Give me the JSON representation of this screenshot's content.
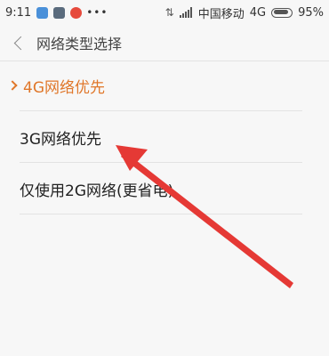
{
  "status_bar": {
    "time": "9:11",
    "dots": "•••",
    "carrier": "中国移动",
    "network": "4G",
    "battery": "95%"
  },
  "header": {
    "title": "网络类型选择"
  },
  "options": [
    {
      "label": "4G网络优先",
      "selected": true
    },
    {
      "label": "3G网络优先",
      "selected": false
    },
    {
      "label": "仅使用2G网络(更省电)",
      "selected": false
    }
  ],
  "colors": {
    "accent": "#e0772a",
    "annotation_arrow": "#e53935"
  }
}
